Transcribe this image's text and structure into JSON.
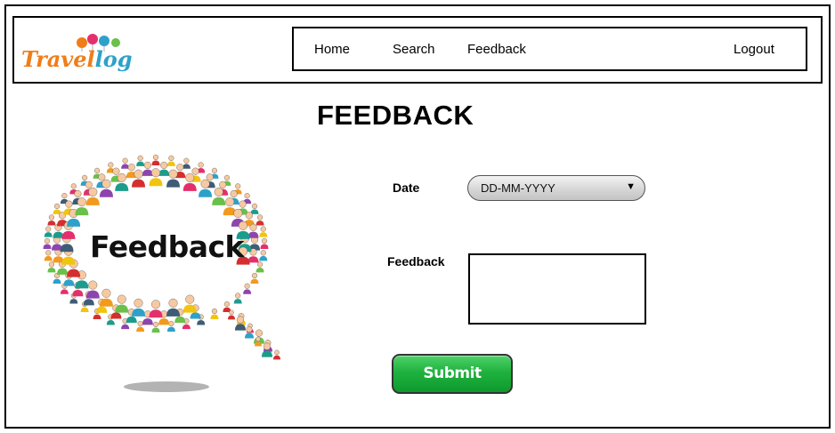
{
  "brand": {
    "logo_part1": "Travel",
    "logo_part2": "log",
    "orange": "#ef7d1a",
    "blue": "#2ea1c9"
  },
  "nav": {
    "items": [
      "Home",
      "Search",
      "Feedback"
    ],
    "logout": "Logout"
  },
  "page": {
    "title": "FEEDBACK"
  },
  "illustration": {
    "label": "Feedback",
    "icon": "people-speech-bubble-icon"
  },
  "form": {
    "date_label": "Date",
    "date_value": "DD-MM-YYYY",
    "feedback_label": "Feedback",
    "feedback_value": "",
    "submit_label": "Submit"
  },
  "colors": {
    "submit_green": "#1fb13e"
  }
}
